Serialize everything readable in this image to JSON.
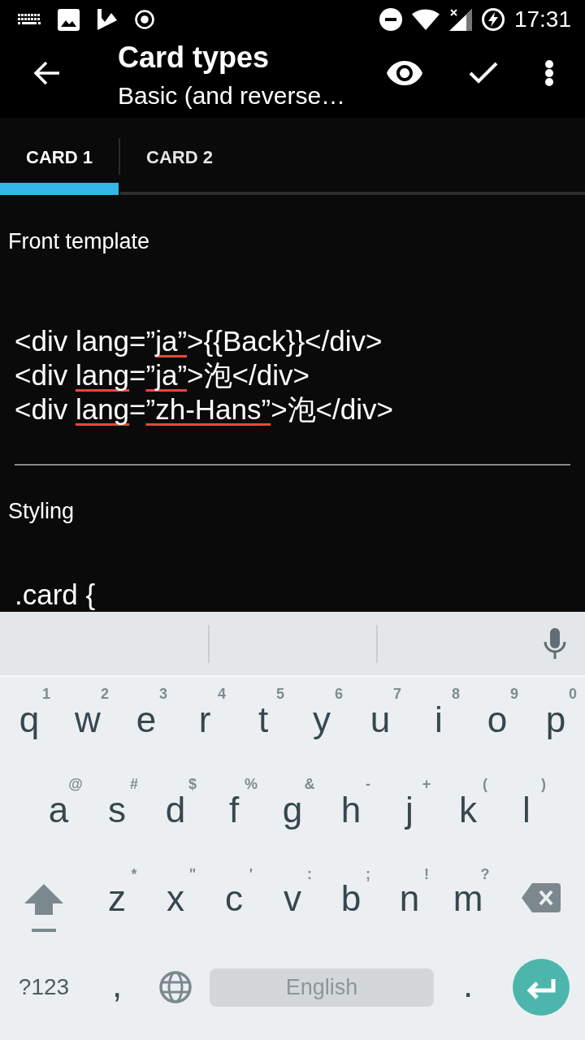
{
  "status_bar": {
    "time": "17:31"
  },
  "toolbar": {
    "title": "Card types",
    "subtitle": "Basic (and reverse…"
  },
  "tabs": [
    {
      "label": "CARD 1",
      "selected": true
    },
    {
      "label": "CARD 2",
      "selected": false
    }
  ],
  "sections": [
    {
      "label": "Front template",
      "lines": [
        [
          {
            "text": "<div lang=”",
            "misspelled": false
          },
          {
            "text": "ja”",
            "misspelled": true
          },
          {
            "text": ">{{Back}}</div>",
            "misspelled": false
          }
        ],
        [
          {
            "text": "<div ",
            "misspelled": false
          },
          {
            "text": "lang",
            "misspelled": true
          },
          {
            "text": "=",
            "misspelled": false
          },
          {
            "text": "”ja”",
            "misspelled": true
          },
          {
            "text": ">泡</div>",
            "misspelled": false
          }
        ],
        [
          {
            "text": "<div ",
            "misspelled": false
          },
          {
            "text": "lang",
            "misspelled": true
          },
          {
            "text": "=",
            "misspelled": false
          },
          {
            "text": "”zh-Hans”",
            "misspelled": true
          },
          {
            "text": ">泡</div>",
            "misspelled": false
          }
        ]
      ]
    },
    {
      "label": "Styling",
      "lines": [
        [
          {
            "text": ".card {",
            "misspelled": false
          }
        ]
      ]
    }
  ],
  "keyboard": {
    "key_rows": [
      {
        "keys": [
          {
            "kind": "letter",
            "label": "q",
            "hint": "1"
          },
          {
            "kind": "letter",
            "label": "w",
            "hint": "2"
          },
          {
            "kind": "letter",
            "label": "e",
            "hint": "3"
          },
          {
            "kind": "letter",
            "label": "r",
            "hint": "4"
          },
          {
            "kind": "letter",
            "label": "t",
            "hint": "5"
          },
          {
            "kind": "letter",
            "label": "y",
            "hint": "6"
          },
          {
            "kind": "letter",
            "label": "u",
            "hint": "7"
          },
          {
            "kind": "letter",
            "label": "i",
            "hint": "8"
          },
          {
            "kind": "letter",
            "label": "o",
            "hint": "9"
          },
          {
            "kind": "letter",
            "label": "p",
            "hint": "0"
          }
        ]
      },
      {
        "keys": [
          {
            "kind": "letter",
            "label": "a",
            "hint": "@"
          },
          {
            "kind": "letter",
            "label": "s",
            "hint": "#"
          },
          {
            "kind": "letter",
            "label": "d",
            "hint": "$"
          },
          {
            "kind": "letter",
            "label": "f",
            "hint": "%"
          },
          {
            "kind": "letter",
            "label": "g",
            "hint": "&"
          },
          {
            "kind": "letter",
            "label": "h",
            "hint": "-"
          },
          {
            "kind": "letter",
            "label": "j",
            "hint": "+"
          },
          {
            "kind": "letter",
            "label": "k",
            "hint": "("
          },
          {
            "kind": "letter",
            "label": "l",
            "hint": ")"
          }
        ]
      },
      {
        "keys": [
          {
            "kind": "shift"
          },
          {
            "kind": "letter",
            "label": "z",
            "hint": "*"
          },
          {
            "kind": "letter",
            "label": "x",
            "hint": "\""
          },
          {
            "kind": "letter",
            "label": "c",
            "hint": "'"
          },
          {
            "kind": "letter",
            "label": "v",
            "hint": ":"
          },
          {
            "kind": "letter",
            "label": "b",
            "hint": ";"
          },
          {
            "kind": "letter",
            "label": "n",
            "hint": "!"
          },
          {
            "kind": "letter",
            "label": "m",
            "hint": "?"
          },
          {
            "kind": "backspace"
          }
        ]
      },
      {
        "keys": [
          {
            "kind": "symbols",
            "label": "?123"
          },
          {
            "kind": "letter",
            "label": ","
          },
          {
            "kind": "globe"
          },
          {
            "kind": "space",
            "label": "English"
          },
          {
            "kind": "letter",
            "label": "."
          },
          {
            "kind": "enter"
          }
        ]
      }
    ]
  }
}
